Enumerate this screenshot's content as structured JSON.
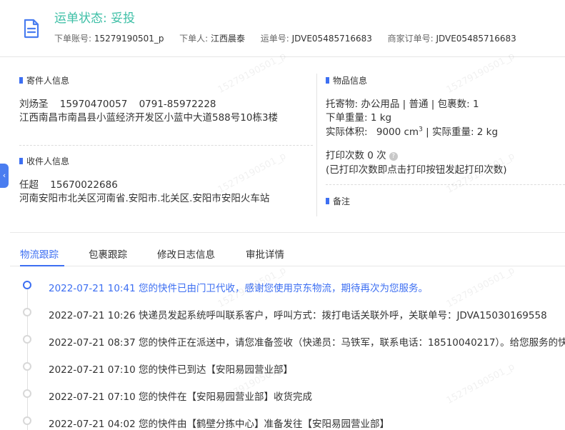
{
  "header": {
    "status_title": "运单状态: 妥投",
    "order_account_label": "下单账号:",
    "order_account": "15279190501_p",
    "orderer_label": "下单人:",
    "orderer": "江西晨泰",
    "waybill_label": "运单号:",
    "waybill": "JDVE05485716683",
    "merchant_order_label": "商家订单号:",
    "merchant_order": "JDVE05485716683"
  },
  "sender": {
    "title": "寄件人信息",
    "name": "刘炀圣",
    "phone": "15970470057",
    "tel": "0791-85972228",
    "address": "江西南昌市南昌县小蓝经济开发区小蓝中大道588号10栋3楼"
  },
  "receiver": {
    "title": "收件人信息",
    "name": "任超",
    "phone": "15670022686",
    "address": "河南安阳市北关区河南省.安阳市.北关区.安阳市安阳火车站"
  },
  "item": {
    "title": "物品信息",
    "line1": "托寄物:  办公用品 | 普通  |  包裹数:  1",
    "weight_line": "下单重量:  1 kg",
    "volume_label": "实际体积:",
    "volume_value": "9000 cm",
    "volume_sup": "3",
    "actual_weight": "|  实际重量:  2 kg",
    "print_count_line": "打印次数   0 次",
    "print_hint": "(已打印次数即点击打印按钮发起打印次数)",
    "remark_title": "备注"
  },
  "side_tab": "‹",
  "tabs": [
    "物流跟踪",
    "包裹跟踪",
    "修改日志信息",
    "审批详情"
  ],
  "timeline": [
    "2022-07-21 10:41 您的快件已由门卫代收，感谢您使用京东物流，期待再次为您服务。",
    "2022-07-21 10:26 快递员发起系统呼叫联系客户，呼叫方式：拨打电话关联外呼，关联单号：JDVA15030169558",
    "2022-07-21 08:37 您的快件正在派送中，请您准备签收（快递员：马铁军，联系电话：18510040217）。给您服务的快",
    "2022-07-21 07:10 您的快件已到达【安阳易园营业部】",
    "2022-07-21 07:10 您的快件在【安阳易园营业部】收货完成",
    "2022-07-21 04:02 您的快件由【鹤壁分拣中心】准备发往【安阳易园营业部】"
  ],
  "watermark": "15279190501_p",
  "colors": {
    "accent": "#3d6ff2",
    "status": "#3dbfa6"
  }
}
